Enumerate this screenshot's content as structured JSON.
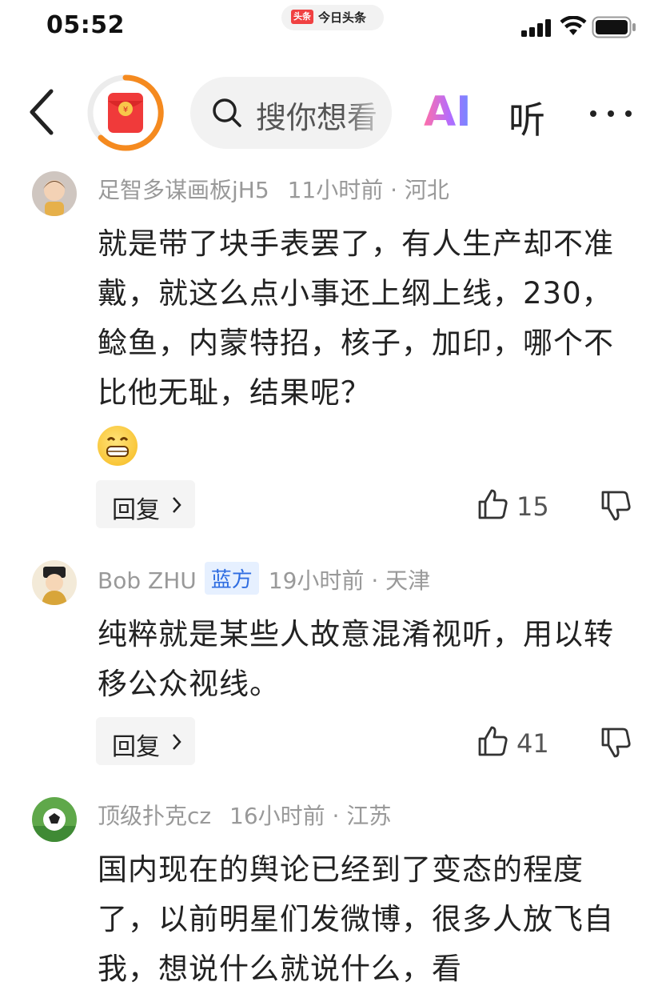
{
  "status_bar": {
    "time": "05:52",
    "app_pill_logo": "头条",
    "app_pill_name": "今日头条"
  },
  "nav": {
    "search_placeholder": "搜你想看",
    "ai_label": "AI",
    "listen_label": "听",
    "icons": [
      "back-chevron-icon",
      "red-packet-icon",
      "search-icon",
      "more-icon"
    ]
  },
  "comments": [
    {
      "user": "足智多谋画板jH5",
      "badge": "",
      "time": "11小时前",
      "location": "河北",
      "text": "就是带了块手表罢了，有人生产却不准戴，就这么点小事还上纲上线，230，鲶鱼，内蒙特招，核子，加印，哪个不比他无耻，结果呢？",
      "reply_label": "回复",
      "likes": "15"
    },
    {
      "user": "Bob ZHU",
      "badge": "蓝方",
      "time": "19小时前",
      "location": "天津",
      "text": "纯粹就是某些人故意混淆视听，用以转移公众视线。",
      "reply_label": "回复",
      "likes": "41"
    },
    {
      "user": "顶级扑克cz",
      "badge": "",
      "time": "16小时前",
      "location": "江苏",
      "text": "国内现在的舆论已经到了变态的程度了，以前明星们发微博，很多人放飞自我，想说什么就说什么，看",
      "reply_label": "",
      "likes": ""
    }
  ],
  "colors": {
    "accent_red": "#f04142",
    "badge_blue": "#2f6de1",
    "muted_gray": "#999999"
  }
}
